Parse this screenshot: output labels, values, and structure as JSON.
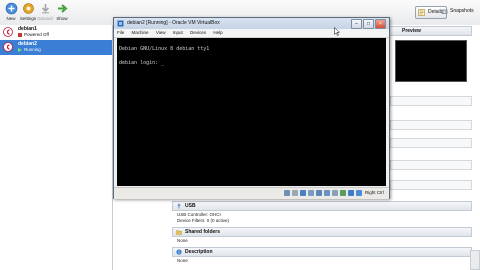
{
  "toolbar": {
    "buttons": [
      {
        "label": "New",
        "icon": "new-vm-icon"
      },
      {
        "label": "Settings",
        "icon": "settings-gear-icon"
      },
      {
        "label": "Discard",
        "icon": "discard-arrow-icon"
      },
      {
        "label": "Show",
        "icon": "show-arrow-icon"
      }
    ],
    "details_label": "Details",
    "snapshots_label": "Snapshots"
  },
  "vm_list": [
    {
      "name": "debian1",
      "state": "Powered Off",
      "selected": false
    },
    {
      "name": "debian2",
      "state": "Running",
      "selected": true
    }
  ],
  "details": {
    "preview_label": "Preview",
    "usb_label": "USB",
    "usb_rows": [
      "Device Filters:  0 (0 active)"
    ],
    "usb_controller": "USB Controller:   OHCI",
    "shared_folders_label": "Shared folders",
    "shared_folders_value": "None",
    "description_label": "Description",
    "description_value": "None"
  },
  "vm_window": {
    "title": "debian2 [Running] - Oracle VM VirtualBox",
    "menu": [
      "File",
      "Machine",
      "View",
      "Input",
      "Devices",
      "Help"
    ],
    "console_lines": [
      "Debian GNU/Linux 8 debian tty1",
      "",
      "debian login: _"
    ],
    "host_key_label": "Right Ctrl"
  },
  "colors": {
    "accent_blue": "#3b7fd4",
    "selected_bg": "#3a7ed6",
    "console_bg": "#000000"
  }
}
